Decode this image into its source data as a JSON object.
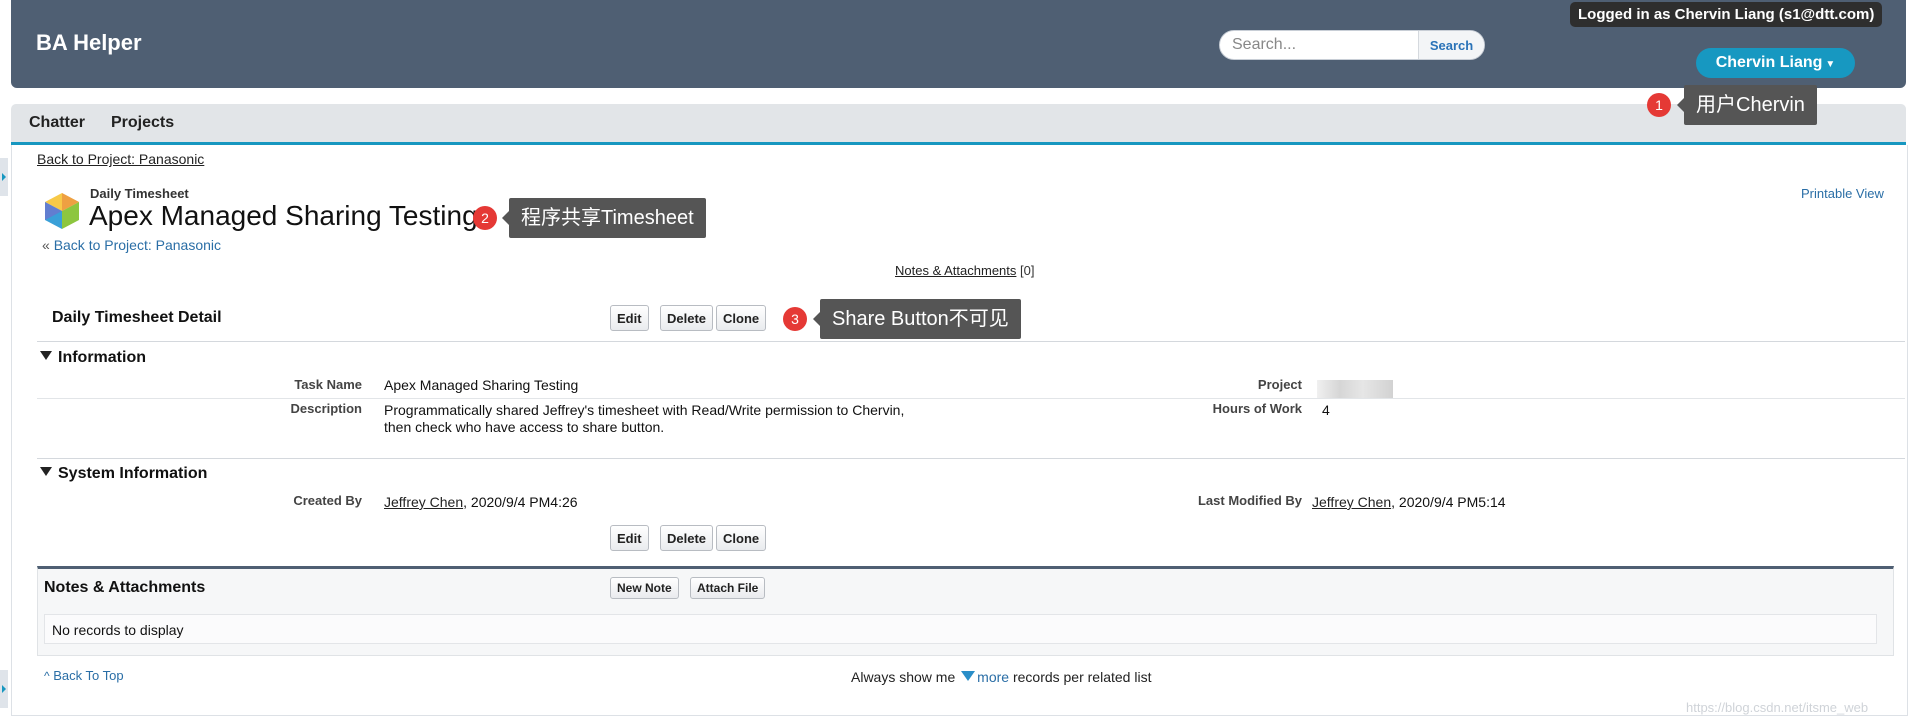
{
  "header": {
    "app_title": "BA Helper",
    "search_placeholder": "Search...",
    "search_button": "Search",
    "logged_in_text": "Logged in as Chervin Liang (s1@dtt.com)",
    "user_menu_label": "Chervin Liang"
  },
  "annotations": [
    {
      "number": "1",
      "text": "用户Chervin"
    },
    {
      "number": "2",
      "text": "程序共享Timesheet"
    },
    {
      "number": "3",
      "text": "Share Button不可见"
    }
  ],
  "tabs": [
    "Chatter",
    "Projects"
  ],
  "breadcrumb_top": "Back to Project: Panasonic",
  "record": {
    "object_type": "Daily Timesheet",
    "title": "Apex Managed Sharing Testing",
    "back_prefix": "«",
    "back_link": "Back to Project: Panasonic",
    "printable_view": "Printable View",
    "notes_link": "Notes & Attachments",
    "notes_count": "[0]"
  },
  "detail": {
    "heading": "Daily Timesheet Detail",
    "buttons": {
      "edit": "Edit",
      "delete": "Delete",
      "clone": "Clone"
    },
    "info_section": "Information",
    "fields": {
      "task_name_label": "Task Name",
      "task_name_value": "Apex Managed Sharing Testing",
      "project_label": "Project",
      "description_label": "Description",
      "description_line1": "Programmatically shared Jeffrey's timesheet with Read/Write permission to Chervin,",
      "description_line2": "then check who have access to share button.",
      "hours_label": "Hours of Work",
      "hours_value": "4"
    },
    "system_section": "System Information",
    "system": {
      "created_by_label": "Created By",
      "created_by_user": "Jeffrey Chen",
      "created_by_date": ", 2020/9/4 PM4:26",
      "modified_by_label": "Last Modified By",
      "modified_by_user": "Jeffrey Chen",
      "modified_by_date": ", 2020/9/4 PM5:14"
    }
  },
  "related": {
    "heading": "Notes & Attachments",
    "new_note": "New Note",
    "attach_file": "Attach File",
    "empty_text": "No records to display"
  },
  "footer": {
    "back_to_top": "Back To Top",
    "always_show": "Always show me",
    "more": "more",
    "per_list": "records per related list"
  },
  "watermark": "https://blog.csdn.net/itsme_web",
  "colors": {
    "header_bg": "#4f5f73",
    "accent": "#1797c0",
    "callout_badge": "#e53935",
    "callout_box": "#555555"
  }
}
